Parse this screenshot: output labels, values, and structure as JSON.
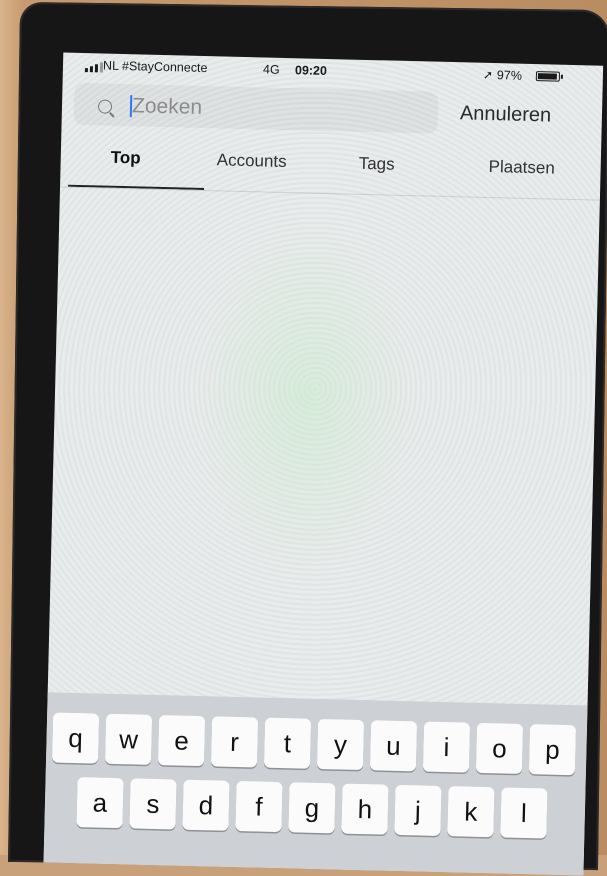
{
  "status_bar": {
    "carrier": "NL #StayConnecte",
    "network": "4G",
    "time": "09:20",
    "battery": "97%",
    "battery_level": 0.97
  },
  "search": {
    "placeholder": "Zoeken",
    "cancel_label": "Annuleren"
  },
  "tabs": [
    {
      "label": "Top",
      "active": true
    },
    {
      "label": "Accounts",
      "active": false
    },
    {
      "label": "Tags",
      "active": false
    },
    {
      "label": "Plaatsen",
      "active": false
    }
  ],
  "keyboard": {
    "row1": [
      "q",
      "w",
      "e",
      "r",
      "t",
      "y",
      "u",
      "i",
      "o",
      "p"
    ],
    "row2": [
      "a",
      "s",
      "d",
      "f",
      "g",
      "h",
      "j",
      "k",
      "l"
    ]
  },
  "colors": {
    "caret": "#3478f6",
    "screen_bg": "#e9ecec",
    "keyboard_bg": "#cdd1d5"
  }
}
